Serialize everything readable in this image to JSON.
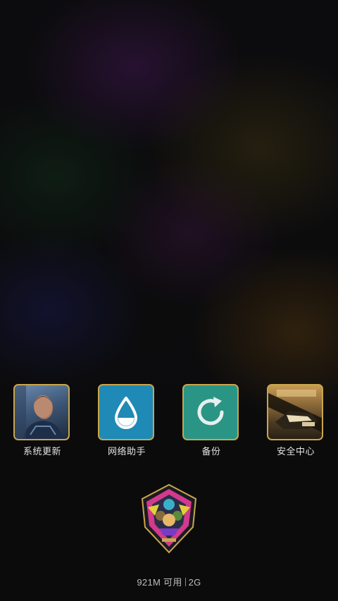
{
  "apps": [
    {
      "label": "系统更新",
      "icon": "system-update-icon"
    },
    {
      "label": "网络助手",
      "icon": "water-drop-icon",
      "color": "#1f8ab5"
    },
    {
      "label": "备份",
      "icon": "refresh-arrow-icon",
      "color": "#2a9585"
    },
    {
      "label": "安全中心",
      "icon": "security-center-icon"
    }
  ],
  "tile_border_color": "#c8a64c",
  "memory": {
    "available": "921M 可用",
    "total": "2G"
  }
}
